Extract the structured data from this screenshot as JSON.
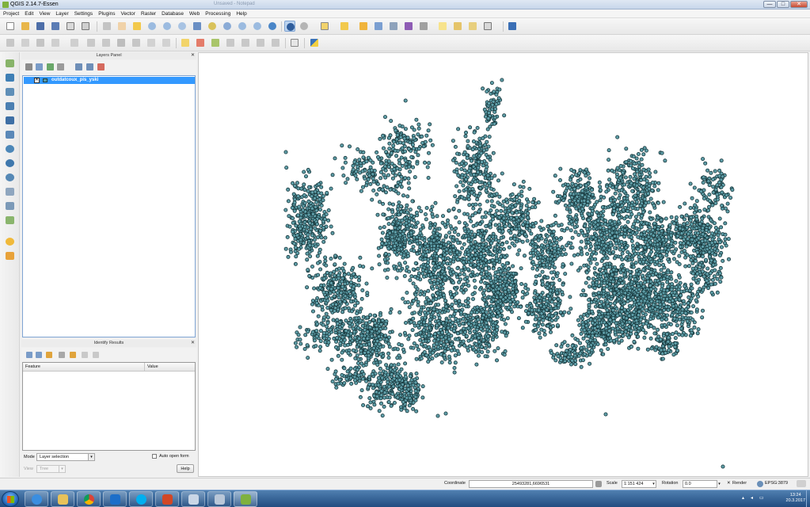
{
  "window": {
    "title": "QGIS 2.14.7-Essen",
    "ghost_title": "Unsaved - Notepad",
    "minimize": "—",
    "maximize": "□",
    "close": "✕"
  },
  "menu": [
    "Project",
    "Edit",
    "View",
    "Layer",
    "Settings",
    "Plugins",
    "Vector",
    "Raster",
    "Database",
    "Web",
    "Processing",
    "Help"
  ],
  "layers_panel": {
    "title": "Layers Panel",
    "layer_name": "outdatcoux_pis_yski",
    "layer_checked": "✕"
  },
  "identify_panel": {
    "title": "Identify Results",
    "col_feature": "Feature",
    "col_value": "Value",
    "mode_label": "Mode",
    "mode_value": "Layer selection",
    "auto_open": "Auto open form",
    "view_label": "View",
    "view_value": "Tree",
    "help": "Help"
  },
  "panel_close": "✕",
  "dropdown_arrow": "▾",
  "statusbar": {
    "coordinate_label": "Coordinate",
    "coordinate_value": "25493281,6696531",
    "scale_label": "Scale",
    "scale_value": "1:151 424",
    "rotation_label": "Rotation",
    "rotation_value": "0.0",
    "render_label": "Render",
    "render_mark": "✕",
    "crs": "EPSG:3879"
  },
  "taskbar": {
    "time": "13:24",
    "date": "20.3.2017"
  },
  "colors": {
    "point_fill": "#5f9ea8",
    "point_stroke": "#16363b",
    "selection": "#3399ff",
    "taskbar": "#224c80"
  }
}
